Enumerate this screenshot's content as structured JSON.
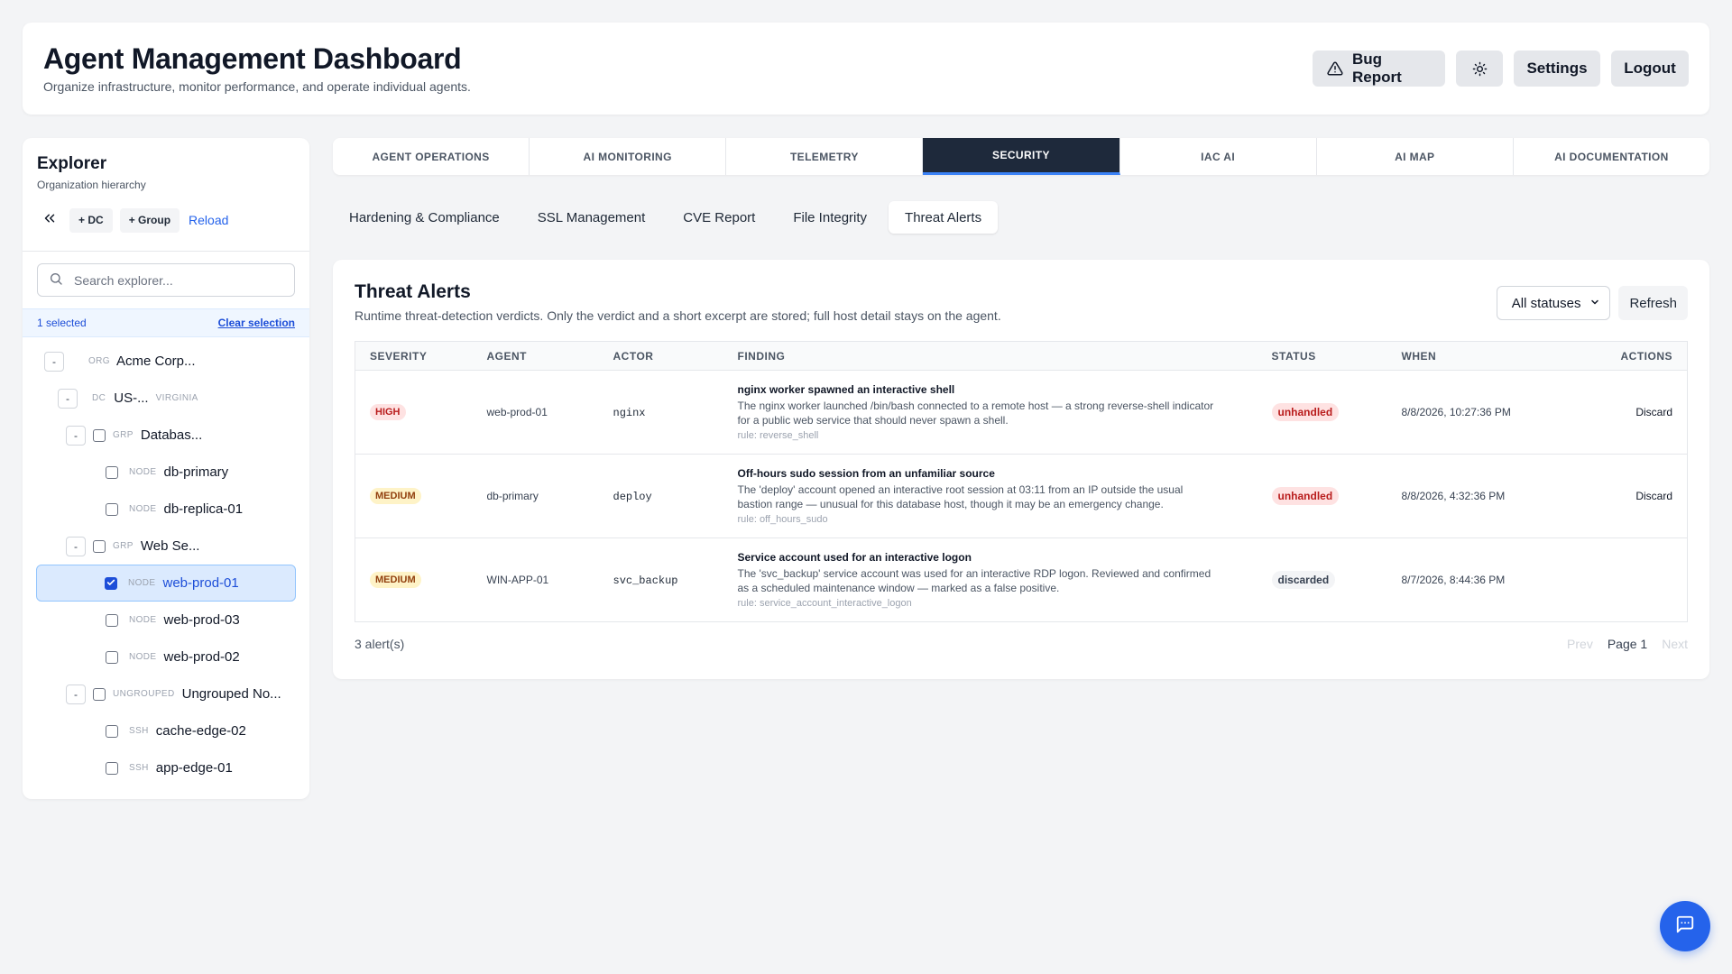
{
  "header": {
    "title": "Agent Management Dashboard",
    "subtitle": "Organize infrastructure, monitor performance, and operate individual agents.",
    "bug_report": "Bug Report",
    "settings": "Settings",
    "logout": "Logout"
  },
  "explorer": {
    "title": "Explorer",
    "subtitle": "Organization hierarchy",
    "add_dc": "+ DC",
    "add_group": "+ Group",
    "reload": "Reload",
    "search_placeholder": "Search explorer...",
    "selected_count": "1 selected",
    "clear_selection": "Clear selection",
    "tree": [
      {
        "toggle": "-",
        "checkbox": false,
        "kind": "ORG",
        "name": "Acme Corp...",
        "region": "",
        "selected": false
      },
      {
        "toggle": "-",
        "checkbox": false,
        "kind": "DC",
        "name": "US-...",
        "region": "VIRGINIA",
        "selected": false
      },
      {
        "toggle": "-",
        "checkbox": true,
        "checked": false,
        "kind": "GRP",
        "name": "Databas...",
        "region": "",
        "selected": false
      },
      {
        "toggle": "",
        "checkbox": true,
        "checked": false,
        "kind": "NODE",
        "name": "db-primary",
        "region": "",
        "selected": false
      },
      {
        "toggle": "",
        "checkbox": true,
        "checked": false,
        "kind": "NODE",
        "name": "db-replica-01",
        "region": "",
        "selected": false
      },
      {
        "toggle": "-",
        "checkbox": true,
        "checked": false,
        "kind": "GRP",
        "name": "Web Se...",
        "region": "",
        "selected": false
      },
      {
        "toggle": "",
        "checkbox": true,
        "checked": true,
        "kind": "NODE",
        "name": "web-prod-01",
        "region": "",
        "selected": true
      },
      {
        "toggle": "",
        "checkbox": true,
        "checked": false,
        "kind": "NODE",
        "name": "web-prod-03",
        "region": "",
        "selected": false
      },
      {
        "toggle": "",
        "checkbox": true,
        "checked": false,
        "kind": "NODE",
        "name": "web-prod-02",
        "region": "",
        "selected": false
      },
      {
        "toggle": "-",
        "checkbox": true,
        "checked": false,
        "kind": "UNGROUPED",
        "name": "Ungrouped No...",
        "region": "",
        "selected": false
      },
      {
        "toggle": "",
        "checkbox": true,
        "checked": false,
        "kind": "SSH",
        "name": "cache-edge-02",
        "region": "",
        "selected": false
      },
      {
        "toggle": "",
        "checkbox": true,
        "checked": false,
        "kind": "SSH",
        "name": "app-edge-01",
        "region": "",
        "selected": false
      }
    ]
  },
  "tabs": [
    {
      "label": "AGENT OPERATIONS",
      "active": false
    },
    {
      "label": "AI MONITORING",
      "active": false
    },
    {
      "label": "TELEMETRY",
      "active": false
    },
    {
      "label": "SECURITY",
      "active": true
    },
    {
      "label": "IAC AI",
      "active": false
    },
    {
      "label": "AI MAP",
      "active": false
    },
    {
      "label": "AI DOCUMENTATION",
      "active": false
    }
  ],
  "subtabs": [
    {
      "label": "Hardening & Compliance",
      "active": false
    },
    {
      "label": "SSL Management",
      "active": false
    },
    {
      "label": "CVE Report",
      "active": false
    },
    {
      "label": "File Integrity",
      "active": false
    },
    {
      "label": "Threat Alerts",
      "active": true
    }
  ],
  "panel": {
    "title": "Threat Alerts",
    "subtitle": "Runtime threat-detection verdicts. Only the verdict and a short excerpt are stored; full host detail stays on the agent.",
    "status_filter": "All statuses",
    "refresh": "Refresh",
    "columns": [
      "SEVERITY",
      "AGENT",
      "ACTOR",
      "FINDING",
      "STATUS",
      "WHEN",
      "ACTIONS"
    ],
    "rows": [
      {
        "severity": "HIGH",
        "agent": "web-prod-01",
        "actor": "nginx",
        "finding_title": "nginx worker spawned an interactive shell",
        "finding_desc": "The nginx worker launched /bin/bash connected to a remote host — a strong reverse-shell indicator for a public web service that should never spawn a shell.",
        "rule": "rule: reverse_shell",
        "status": "unhandled",
        "when": "8/8/2026, 10:27:36 PM",
        "action": "Discard"
      },
      {
        "severity": "MEDIUM",
        "agent": "db-primary",
        "actor": "deploy",
        "finding_title": "Off-hours sudo session from an unfamiliar source",
        "finding_desc": "The 'deploy' account opened an interactive root session at 03:11 from an IP outside the usual bastion range — unusual for this database host, though it may be an emergency change.",
        "rule": "rule: off_hours_sudo",
        "status": "unhandled",
        "when": "8/8/2026, 4:32:36 PM",
        "action": "Discard"
      },
      {
        "severity": "MEDIUM",
        "agent": "WIN-APP-01",
        "actor": "svc_backup",
        "finding_title": "Service account used for an interactive logon",
        "finding_desc": "The 'svc_backup' service account was used for an interactive RDP logon. Reviewed and confirmed as a scheduled maintenance window — marked as a false positive.",
        "rule": "rule: service_account_interactive_logon",
        "status": "discarded",
        "when": "8/7/2026, 8:44:36 PM",
        "action": ""
      }
    ],
    "count": "3 alert(s)",
    "prev": "Prev",
    "page": "Page 1",
    "next": "Next"
  },
  "colors": {
    "accent": "#2563eb",
    "active_tab": "#1e293b",
    "high": "#b91c1c",
    "medium": "#92400e"
  }
}
